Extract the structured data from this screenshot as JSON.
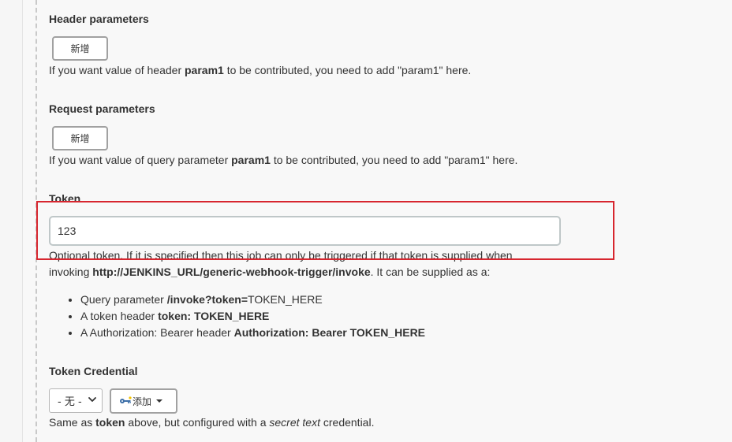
{
  "header_params": {
    "title": "Header parameters",
    "add_label": "新增",
    "help_prefix": "If you want value of header ",
    "help_bold": "param1",
    "help_suffix": " to be contributed, you need to add \"param1\" here."
  },
  "request_params": {
    "title": "Request parameters",
    "add_label": "新增",
    "help_prefix": "If you want value of query parameter ",
    "help_bold": "param1",
    "help_suffix": " to be contributed, you need to add \"param1\" here."
  },
  "token": {
    "title": "Token",
    "value": "123",
    "help_line1": "Optional token. If it is specified then this job can only be triggered if that token is supplied when",
    "help_line2_prefix": "invoking ",
    "help_line2_bold": "http://JENKINS_URL/generic-webhook-trigger/invoke",
    "help_line2_suffix": ". It can be supplied as a:",
    "bullets": [
      {
        "prefix": "Query parameter ",
        "bold": "/invoke?token=",
        "suffix": "TOKEN_HERE"
      },
      {
        "prefix": "A token header ",
        "bold": "token:",
        "suffix": " TOKEN_HERE"
      },
      {
        "prefix": "A Authorization: Bearer header ",
        "bold": "Authorization: Bearer TOKEN_HERE",
        "suffix": ""
      }
    ],
    "highlight_color": "#d7262f"
  },
  "token_credential": {
    "title": "Token Credential",
    "select_value": "- 无 -",
    "add_label": "添加",
    "help_prefix": "Same as ",
    "help_bold": "token",
    "help_middle": " above, but configured with a ",
    "help_italic": "secret text",
    "help_suffix": " credential."
  }
}
